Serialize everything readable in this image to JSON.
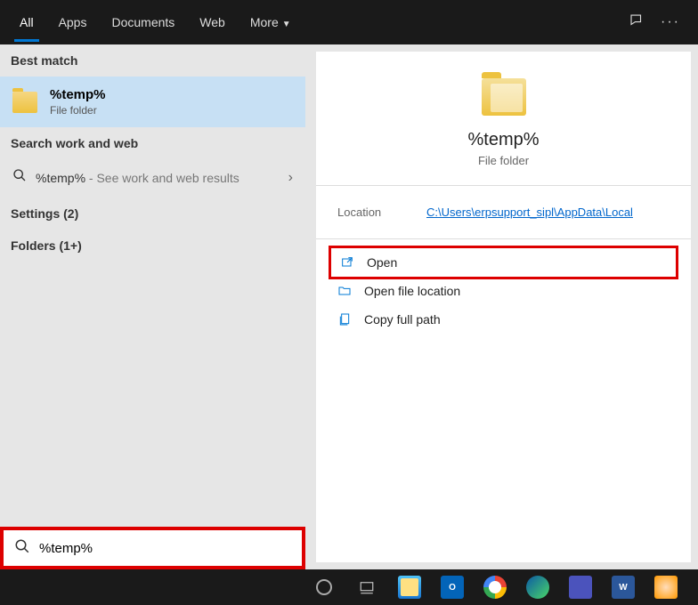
{
  "tabs": [
    "All",
    "Apps",
    "Documents",
    "Web",
    "More"
  ],
  "activeTab": 0,
  "sections": {
    "bestMatch": "Best match",
    "searchWeb": "Search work and web",
    "settings": "Settings (2)",
    "folders": "Folders (1+)"
  },
  "result": {
    "title": "%temp%",
    "subtitle": "File folder"
  },
  "webResult": {
    "query": "%temp%",
    "hint": " - See work and web results"
  },
  "preview": {
    "title": "%temp%",
    "subtitle": "File folder",
    "locationLabel": "Location",
    "locationValue": "C:\\Users\\erpsupport_sipl\\AppData\\Local"
  },
  "actions": {
    "open": "Open",
    "openLoc": "Open file location",
    "copyPath": "Copy full path"
  },
  "search": {
    "value": "%temp%"
  },
  "outlook": "O",
  "word": "W"
}
